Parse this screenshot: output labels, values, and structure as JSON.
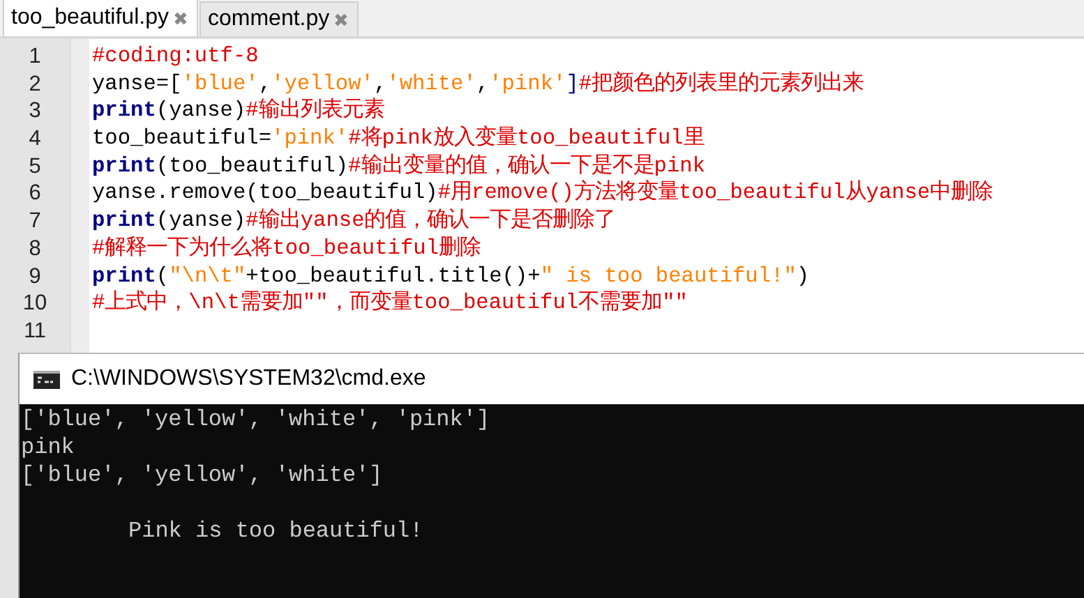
{
  "tabs": [
    {
      "label": "too_beautiful.py",
      "selected": true,
      "close": "✖"
    },
    {
      "label": "comment.py",
      "selected": false,
      "close": "✖"
    }
  ],
  "editor": {
    "lines": [
      {
        "number": "1",
        "tokens": [
          {
            "kind": "comment",
            "text": "#coding:utf-8"
          }
        ]
      },
      {
        "number": "2",
        "tokens": [
          {
            "kind": "plain",
            "text": "yanse=["
          },
          {
            "kind": "string",
            "text": "'blue'"
          },
          {
            "kind": "plain",
            "text": ","
          },
          {
            "kind": "string",
            "text": "'yellow'"
          },
          {
            "kind": "plain",
            "text": ","
          },
          {
            "kind": "string",
            "text": "'white'"
          },
          {
            "kind": "plain",
            "text": ","
          },
          {
            "kind": "string",
            "text": "'pink'"
          },
          {
            "kind": "op",
            "text": "]"
          },
          {
            "kind": "comment",
            "text": "#把颜色的列表里的元素列出来"
          }
        ]
      },
      {
        "number": "3",
        "tokens": [
          {
            "kind": "keyword",
            "text": "print"
          },
          {
            "kind": "plain",
            "text": "(yanse)"
          },
          {
            "kind": "comment",
            "text": "#输出列表元素"
          }
        ]
      },
      {
        "number": "4",
        "tokens": [
          {
            "kind": "plain",
            "text": "too_beautiful="
          },
          {
            "kind": "string",
            "text": "'pink'"
          },
          {
            "kind": "comment",
            "text": "#将pink放入变量too_beautiful里"
          }
        ]
      },
      {
        "number": "5",
        "tokens": [
          {
            "kind": "keyword",
            "text": "print"
          },
          {
            "kind": "plain",
            "text": "(too_beautiful)"
          },
          {
            "kind": "comment",
            "text": "#输出变量的值，确认一下是不是pink"
          }
        ]
      },
      {
        "number": "6",
        "tokens": [
          {
            "kind": "plain",
            "text": "yanse.remove(too_beautiful)"
          },
          {
            "kind": "comment",
            "text": "#用remove()方法将变量too_beautiful从yanse中删除"
          }
        ]
      },
      {
        "number": "7",
        "tokens": [
          {
            "kind": "keyword",
            "text": "print"
          },
          {
            "kind": "plain",
            "text": "(yanse)"
          },
          {
            "kind": "comment",
            "text": "#输出yanse的值，确认一下是否删除了"
          }
        ]
      },
      {
        "number": "8",
        "tokens": [
          {
            "kind": "comment",
            "text": "#解释一下为什么将too_beautiful删除"
          }
        ]
      },
      {
        "number": "9",
        "tokens": [
          {
            "kind": "keyword",
            "text": "print"
          },
          {
            "kind": "plain",
            "text": "("
          },
          {
            "kind": "string",
            "text": "\"\\n\\t\""
          },
          {
            "kind": "plain",
            "text": "+too_beautiful.title()+"
          },
          {
            "kind": "string",
            "text": "\" is too beautiful!\""
          },
          {
            "kind": "plain",
            "text": ")"
          }
        ]
      },
      {
        "number": "10",
        "tokens": [
          {
            "kind": "comment",
            "text": "#上式中，\\n\\t需要加\"\"，而变量too_beautiful不需要加\"\""
          }
        ]
      },
      {
        "number": "11"
      }
    ]
  },
  "console": {
    "title": "C:\\WINDOWS\\SYSTEM32\\cmd.exe",
    "output": [
      {
        "kind": "line",
        "text": "['blue', 'yellow', 'white', 'pink']"
      },
      {
        "kind": "line",
        "text": "pink"
      },
      {
        "kind": "line",
        "text": "['blue', 'yellow', 'white']"
      },
      {
        "kind": "tabbed",
        "text": "Pink is too beautiful!"
      }
    ]
  }
}
